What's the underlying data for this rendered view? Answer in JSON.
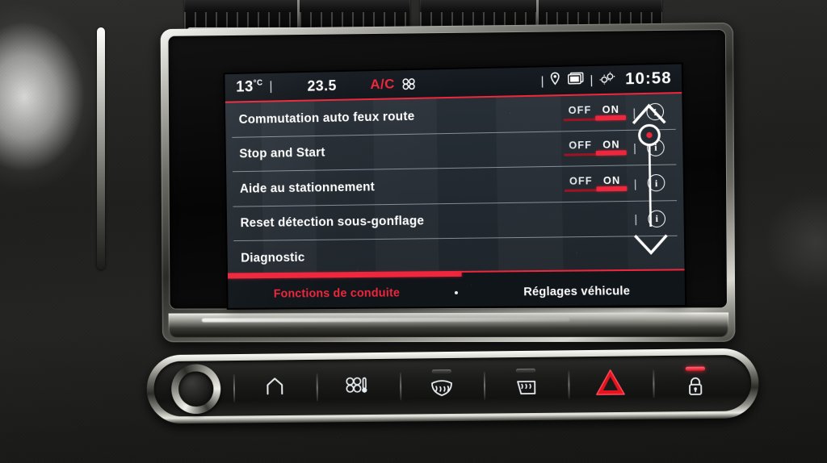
{
  "screen": {
    "status_bar": {
      "temperature": "13",
      "temperature_unit": "°C",
      "separator": "|",
      "set_value": "23.5",
      "ac_label": "A/C",
      "fan_icon": "fan-icon",
      "location_icon": "location-pin-icon",
      "windows_icon": "multi-window-icon",
      "settings_icon": "gears-icon",
      "clock": "10:58"
    },
    "menu_rows": [
      {
        "label": "Commutation auto feux route",
        "has_toggle": true,
        "off_label": "OFF",
        "on_label": "ON",
        "state": "ON",
        "has_info": true
      },
      {
        "label": "Stop and Start",
        "has_toggle": true,
        "off_label": "OFF",
        "on_label": "ON",
        "state": "ON",
        "has_info": true
      },
      {
        "label": "Aide au stationnement",
        "has_toggle": true,
        "off_label": "OFF",
        "on_label": "ON",
        "state": "ON",
        "has_info": true
      },
      {
        "label": "Reset détection sous-gonflage",
        "has_toggle": false,
        "off_label": "",
        "on_label": "",
        "state": "",
        "has_info": true
      },
      {
        "label": "Diagnostic",
        "has_toggle": false,
        "off_label": "",
        "on_label": "",
        "state": "",
        "has_info": false
      }
    ],
    "scroller": {
      "up_icon": "chevron-up-icon",
      "down_icon": "chevron-down-icon",
      "handle_icon": "scroll-handle-icon"
    },
    "tabs": {
      "active": "Fonctions de conduite",
      "inactive": "Réglages véhicule",
      "dot": "page-dot",
      "progress_percent": 52
    }
  },
  "hard_buttons": [
    {
      "name": "volume-knob",
      "icon": "rotary-knob-icon",
      "led": "none"
    },
    {
      "name": "home-button",
      "icon": "home-icon",
      "led": "none"
    },
    {
      "name": "climate-button",
      "icon": "fan-thermometer-icon",
      "led": "none"
    },
    {
      "name": "front-defrost-button",
      "icon": "front-defrost-icon",
      "led": "off"
    },
    {
      "name": "rear-defrost-button",
      "icon": "rear-defrost-icon",
      "led": "off"
    },
    {
      "name": "hazard-button",
      "icon": "hazard-triangle-icon",
      "led": "none"
    },
    {
      "name": "door-lock-button",
      "icon": "padlock-icon",
      "led": "red"
    }
  ],
  "colors": {
    "accent_red": "#f0263c",
    "accent_red_dim": "#9e1323",
    "screen_bg": "#232b33",
    "status_bg": "#11161b",
    "text_white": "#ffffff"
  }
}
